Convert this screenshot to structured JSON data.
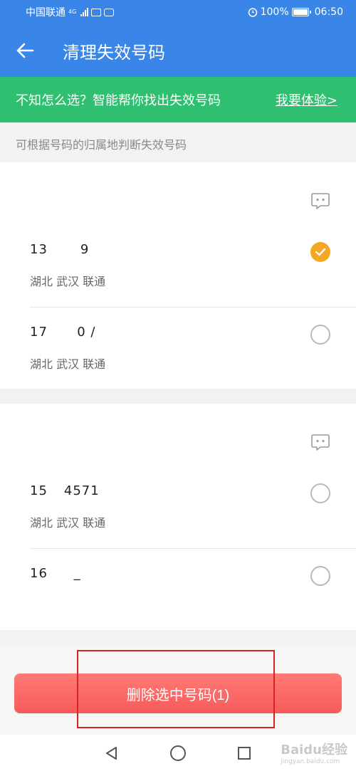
{
  "status_bar": {
    "carrier": "中国联通",
    "network": "4G",
    "battery": "100%",
    "time": "06:50"
  },
  "app_bar": {
    "title": "清理失效号码"
  },
  "banner": {
    "text": "不知怎么选？智能帮你找出失效号码",
    "link": "我要体验>"
  },
  "hint": "可根据号码的归属地判断失效号码",
  "groups": [
    {
      "name": "   ",
      "rows": [
        {
          "number": "13          9",
          "location": "湖北 武汉 联通",
          "checked": true
        },
        {
          "number": "17         0 /",
          "location": "湖北 武汉 联通",
          "checked": false
        }
      ]
    },
    {
      "name": "   ",
      "rows": [
        {
          "number": "15     4571",
          "location": "湖北 武汉 联通",
          "checked": false
        },
        {
          "number": "16        _",
          "location": "",
          "checked": false
        }
      ]
    }
  ],
  "delete_button": "删除选中号码(1)",
  "watermark": {
    "text": "Baidu经验",
    "sub": "jingyan.baidu.com"
  },
  "colors": {
    "primary": "#3a86e8",
    "banner": "#2fbf71",
    "checked": "#f5a623",
    "delete": "#f75a5a",
    "highlight": "#d62424"
  }
}
